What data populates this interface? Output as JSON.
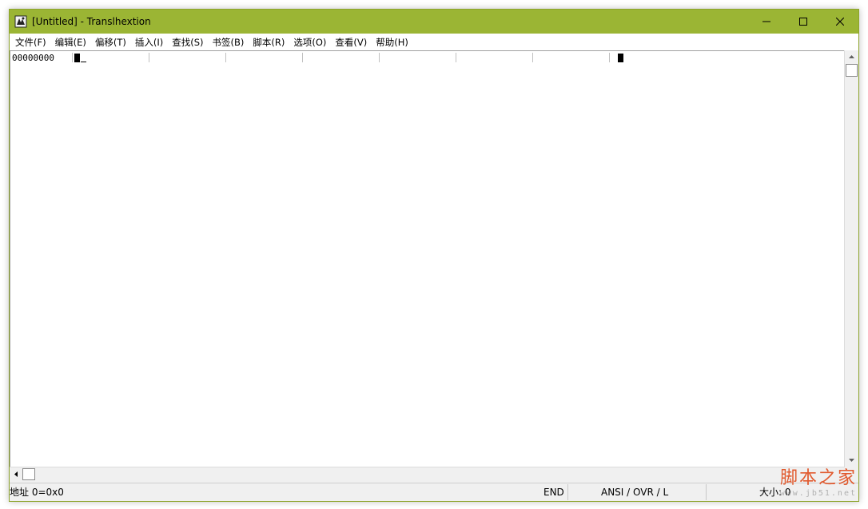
{
  "window": {
    "title": "[Untitled] - Translhextion",
    "controls": {
      "minimize": "minimize-icon",
      "maximize": "maximize-icon",
      "close": "close-icon"
    }
  },
  "menu": {
    "items": [
      {
        "label": "文件(F)"
      },
      {
        "label": "编辑(E)"
      },
      {
        "label": "偏移(T)"
      },
      {
        "label": "插入(I)"
      },
      {
        "label": "查找(S)"
      },
      {
        "label": "书签(B)"
      },
      {
        "label": "脚本(R)"
      },
      {
        "label": "选项(O)"
      },
      {
        "label": "查看(V)"
      },
      {
        "label": "帮助(H)"
      }
    ]
  },
  "editor": {
    "offset": "00000000"
  },
  "statusbar": {
    "address": "地址 0=0x0",
    "mode_end": "END",
    "encoding": "ANSI / OVR / L",
    "size": "大小: 0"
  },
  "watermark": {
    "cn": "脚本之家",
    "url": "www.jb51.net"
  },
  "colors": {
    "titlebar": "#9bb534",
    "accent_watermark": "#e04a1a"
  }
}
